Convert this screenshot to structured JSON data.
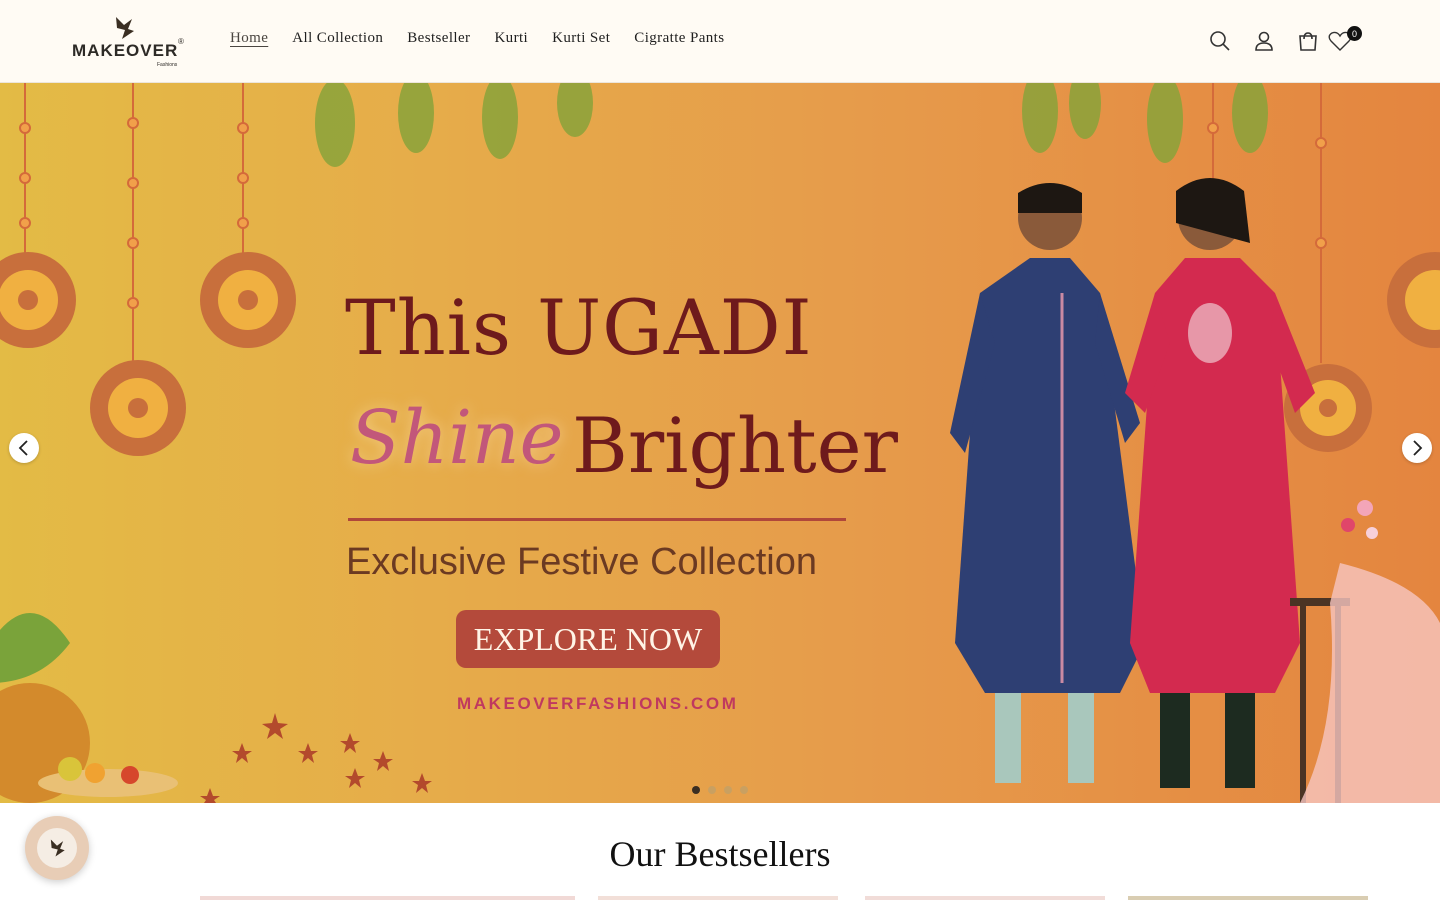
{
  "brand": {
    "name": "MAKEOVER",
    "sub": "Fashions",
    "reg": "®"
  },
  "nav": {
    "items": [
      {
        "label": "Home",
        "active": true
      },
      {
        "label": "All Collection",
        "active": false
      },
      {
        "label": "Bestseller",
        "active": false
      },
      {
        "label": "Kurti",
        "active": false
      },
      {
        "label": "Kurti Set",
        "active": false
      },
      {
        "label": "Cigratte Pants",
        "active": false
      }
    ]
  },
  "header_icons": {
    "search": "search-icon",
    "account": "user-icon",
    "cart": "cart-icon",
    "wishlist": "heart-icon",
    "wishlist_count": "0"
  },
  "hero": {
    "line1": "This UGADI",
    "shine": "Shine",
    "brighter": "Brighter",
    "subtitle": "Exclusive Festive Collection",
    "button": "EXPLORE NOW",
    "url": "MAKEOVERFASHIONS.COM",
    "slide_count": 4,
    "active_slide": 1
  },
  "section": {
    "title": "Our Bestsellers"
  },
  "colors": {
    "header_bg": "#fffbf4",
    "hero_text": "#6e1a1c",
    "shine": "#c2577a",
    "button": "#b44a3b",
    "url": "#c0395f"
  }
}
